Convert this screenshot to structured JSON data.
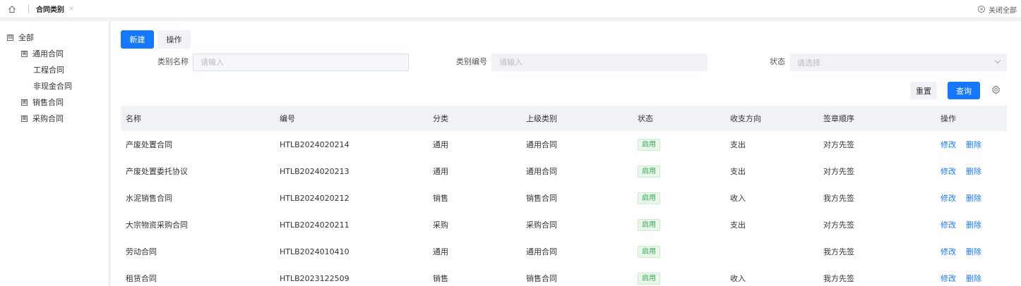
{
  "tabbar": {
    "home_icon": "home-icon",
    "active_tab": "合同类别",
    "close_all": "关闭全部"
  },
  "sidebar": {
    "tree": [
      {
        "label": "全部",
        "toggle": "⊟",
        "level": 0
      },
      {
        "label": "通用合同",
        "toggle": "⊞",
        "level": 1
      },
      {
        "label": "工程合同",
        "toggle": "",
        "level": 2
      },
      {
        "label": "非现金合同",
        "toggle": "",
        "level": 2
      },
      {
        "label": "销售合同",
        "toggle": "⊞",
        "level": 1
      },
      {
        "label": "采购合同",
        "toggle": "⊞",
        "level": 1
      }
    ]
  },
  "toolbar": {
    "new_label": "新建",
    "ops_label": "操作"
  },
  "filters": {
    "name_label": "类别名称",
    "name_placeholder": "请输入",
    "code_label": "类别编号",
    "code_placeholder": "请输入",
    "status_label": "状态",
    "status_placeholder": "请选择",
    "reset_label": "重置",
    "query_label": "查询"
  },
  "table": {
    "headers": [
      "名称",
      "编号",
      "分类",
      "上级类别",
      "状态",
      "收支方向",
      "签章顺序",
      "操作"
    ],
    "edit_label": "修改",
    "delete_label": "删除",
    "rows": [
      {
        "name": "产废处置合同",
        "code": "HTLB2024020214",
        "category": "通用",
        "parent": "通用合同",
        "status": "启用",
        "direction": "支出",
        "order": "对方先签"
      },
      {
        "name": "产废处置委托协议",
        "code": "HTLB2024020213",
        "category": "通用",
        "parent": "通用合同",
        "status": "启用",
        "direction": "支出",
        "order": "对方先签"
      },
      {
        "name": "水泥销售合同",
        "code": "HTLB2024020212",
        "category": "销售",
        "parent": "销售合同",
        "status": "启用",
        "direction": "收入",
        "order": "我方先签"
      },
      {
        "name": "大宗物资采购合同",
        "code": "HTLB2024020211",
        "category": "采购",
        "parent": "采购合同",
        "status": "启用",
        "direction": "支出",
        "order": "对方先签"
      },
      {
        "name": "劳动合同",
        "code": "HTLB2024010410",
        "category": "通用",
        "parent": "通用合同",
        "status": "启用",
        "direction": "",
        "order": "我方先签"
      },
      {
        "name": "租赁合同",
        "code": "HTLB2023122509",
        "category": "销售",
        "parent": "销售合同",
        "status": "启用",
        "direction": "收入",
        "order": "我方先签"
      }
    ]
  },
  "colors": {
    "primary": "#1677ff",
    "status_green": "#3aa757"
  }
}
